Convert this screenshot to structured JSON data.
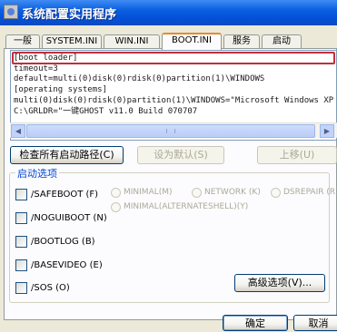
{
  "window": {
    "title": "系统配置实用程序"
  },
  "tabs": [
    "一般",
    "SYSTEM.INI",
    "WIN.INI",
    "BOOT.INI",
    "服务",
    "启动"
  ],
  "boot_ini_lines": [
    "[boot loader]",
    "timeout=3",
    "default=multi(0)disk(0)rdisk(0)partition(1)\\WINDOWS",
    "[operating systems]",
    "multi(0)disk(0)rdisk(0)partition(1)\\WINDOWS=\"Microsoft Windows XP",
    "C:\\GRLDR=\"一键GHOST v11.0 Build 070707"
  ],
  "buttons": {
    "check_all": "检查所有启动路径(C)",
    "set_default": "设为默认(S)",
    "move_up": "上移(U)",
    "advanced": "高级选项(V)...",
    "ok": "确定",
    "cancel": "取消"
  },
  "boot_options": {
    "group_label": "启动选项",
    "checkboxes": [
      "/SAFEBOOT (F)",
      "/NOGUIBOOT (N)",
      "/BOOTLOG (B)",
      "/BASEVIDEO (E)",
      "/SOS (O)"
    ],
    "radios": [
      "MINIMAL(M)",
      "NETWORK (K)",
      "DSREPAIR (R)",
      "MINIMAL(ALTERNATESHELL)(Y)"
    ]
  },
  "icons": [
    "app-icon",
    "scroll-left-icon",
    "scroll-right-icon",
    "mouse-cursor-icon"
  ]
}
